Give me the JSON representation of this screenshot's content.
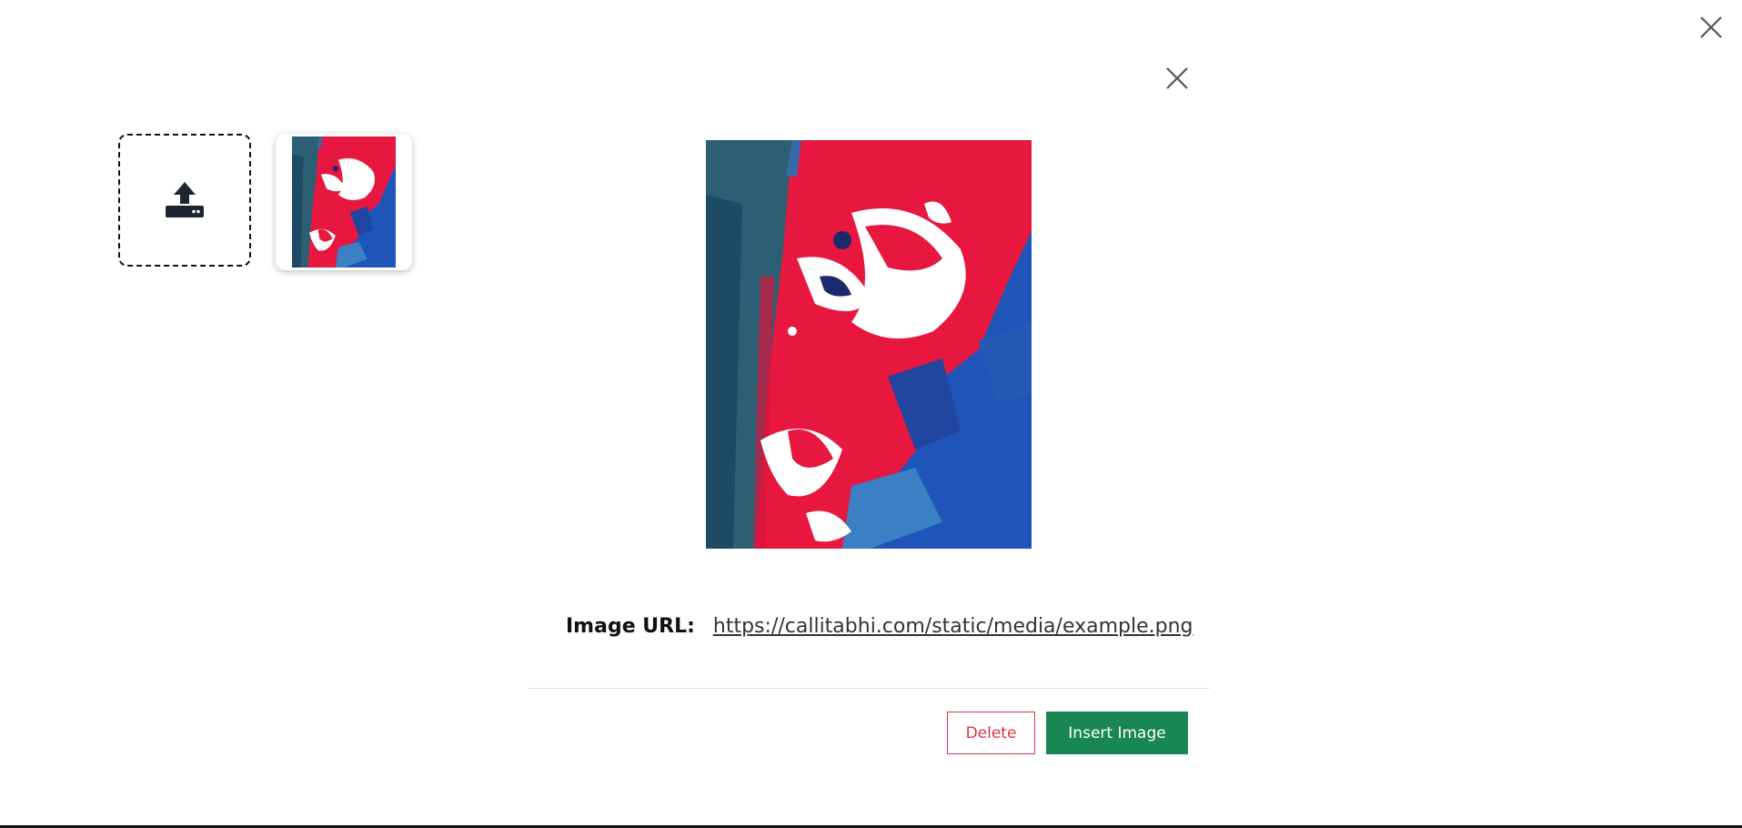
{
  "modal": {
    "image_url_label": "Image URL:",
    "image_url_value": "https://callitabhi.com/static/media/example.png",
    "delete_label": "Delete",
    "insert_label": "Insert Image"
  },
  "icons": {
    "page_close": "close-icon",
    "modal_close": "close-icon",
    "upload": "upload-icon"
  },
  "colors": {
    "delete": "#dc3545",
    "insert": "#198754",
    "art_red": "#e8173f",
    "art_blue": "#1f55b8",
    "art_teal": "#2c5f73"
  }
}
